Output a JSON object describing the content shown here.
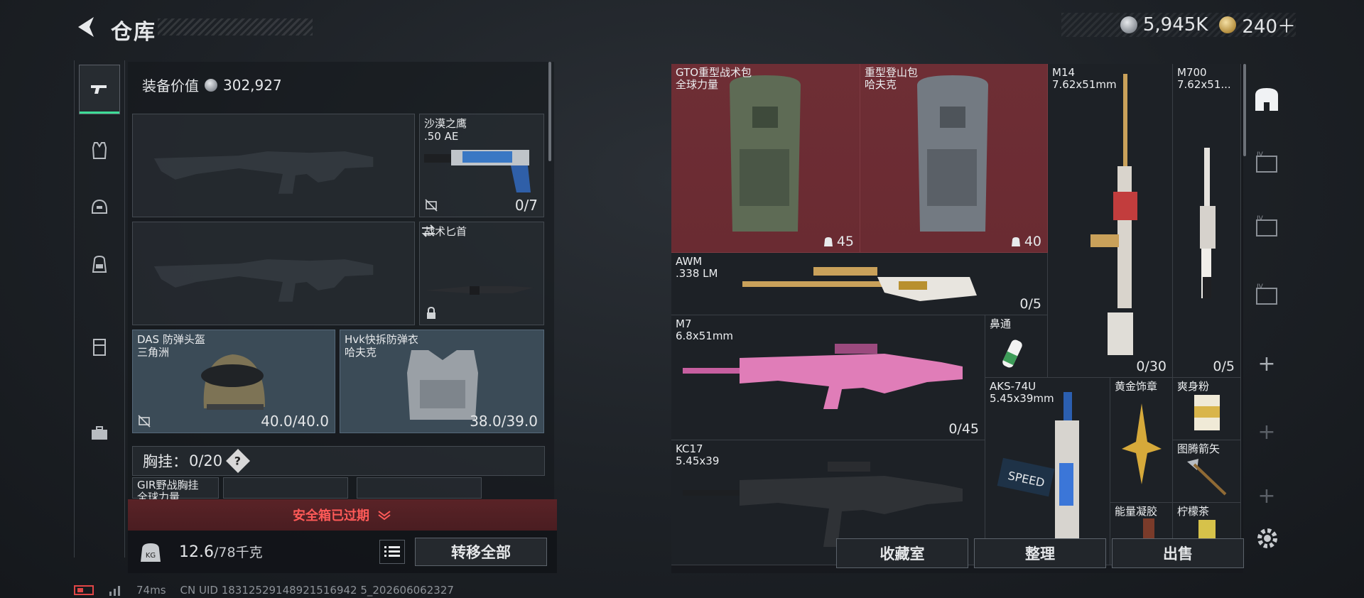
{
  "header": {
    "title": "仓库"
  },
  "currency": {
    "silver": "5,945K",
    "gold": "240＋"
  },
  "loadout": {
    "value_label": "装备价值",
    "value": "302,927",
    "sidearm": {
      "name": "沙漠之鹰\n.50 AE",
      "count": "0/7"
    },
    "melee": {
      "name": "战术匕首"
    },
    "helmet": {
      "name": "DAS 防弹头盔\n三角洲",
      "durability": "40.0/40.0"
    },
    "armor": {
      "name": "Hvk快拆防弹衣\n哈夫克",
      "durability": "38.0/39.0"
    },
    "chest_label": "胸挂：",
    "chest_value": "0/20",
    "chest_help": "?",
    "chest_item": "GIR野战胸挂\n全球力量"
  },
  "safe_banner": "安全箱已过期",
  "weight": {
    "value": "12.6",
    "max": "/78千克"
  },
  "transfer_all": "转移全部",
  "storage": {
    "items": [
      {
        "name": "GTO重型战术包\n全球力量",
        "cap": "45"
      },
      {
        "name": "重型登山包\n哈夫克",
        "cap": "40"
      },
      {
        "name": "M14\n7.62x51mm",
        "count": "0/30"
      },
      {
        "name": "M700\n7.62x51...",
        "count": "0/5"
      },
      {
        "name": "AWM\n.338 LM",
        "count": "0/5"
      },
      {
        "name": "M7\n6.8x51mm",
        "count": "0/45"
      },
      {
        "name": "鼻通"
      },
      {
        "name": "AKS-74U\n5.45x39mm"
      },
      {
        "name": "黄金饰章"
      },
      {
        "name": "爽身粉"
      },
      {
        "name": "KC17\n5.45x39"
      },
      {
        "name": "图腾箭矢"
      },
      {
        "name": "能量凝胶"
      },
      {
        "name": "柠檬茶"
      }
    ]
  },
  "buttons": {
    "collection": "收藏室",
    "sort": "整理",
    "sell": "出售"
  },
  "footer": {
    "ping": "74ms",
    "uid": "CN UID 18312529148921516942 5_202606062327"
  },
  "colors": {
    "accent": "#3ddc97",
    "danger": "#ff5a58",
    "rare": "#6e2e35"
  }
}
